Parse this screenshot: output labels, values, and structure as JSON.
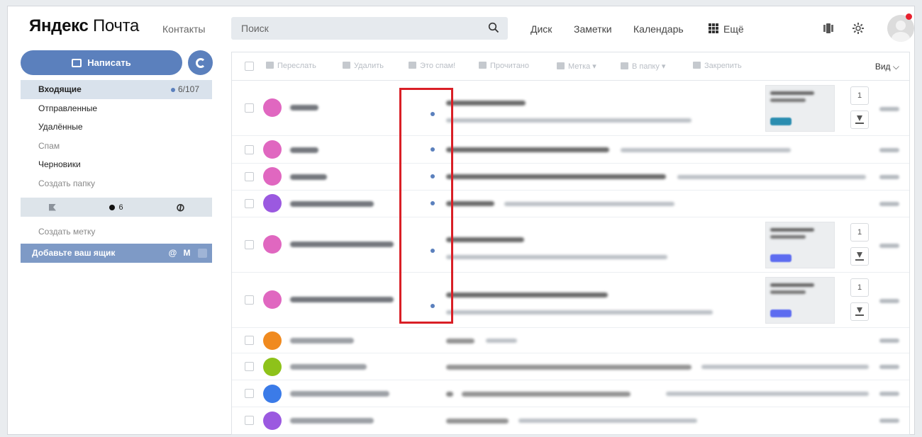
{
  "header": {
    "logo_a": "Яндекс",
    "logo_b": "Почта",
    "contacts": "Контакты",
    "search_placeholder": "Поиск",
    "nav": [
      "Диск",
      "Заметки",
      "Календарь"
    ],
    "more": "Ещё",
    "icons": [
      "search-icon",
      "grid-icon",
      "phone-icon",
      "settings-icon",
      "avatar-icon"
    ]
  },
  "sidebar": {
    "compose": "Написать",
    "folders": [
      {
        "label": "Входящие",
        "count": "6/107",
        "active": true
      },
      {
        "label": "Отправленные"
      },
      {
        "label": "Удалённые"
      },
      {
        "label": "Спам",
        "muted": true
      },
      {
        "label": "Черновики"
      },
      {
        "label": "Создать папку",
        "muted": true
      }
    ],
    "filter_unread_count": "6",
    "create_label": "Создать метку",
    "add_mailbox": "Добавьте ваш ящик"
  },
  "toolbar": {
    "forward": "Переслать",
    "delete": "Удалить",
    "spam": "Это спам!",
    "read": "Прочитано",
    "label": "Метка",
    "to_folder": "В папку",
    "pin": "Закрепить",
    "view": "Вид"
  },
  "messages": [
    {
      "unread": true,
      "avatar_color": "#e067c0",
      "has_attachments": true,
      "attach_count": "1"
    },
    {
      "unread": true,
      "avatar_color": "#e067c0"
    },
    {
      "unread": true,
      "avatar_color": "#e067c0"
    },
    {
      "unread": true,
      "avatar_color": "#9b59e0"
    },
    {
      "unread": true,
      "avatar_color": "#e067c0",
      "has_attachments": true,
      "attach_count": "1"
    },
    {
      "unread": true,
      "avatar_color": "#e067c0",
      "has_attachments": true,
      "attach_count": "1"
    },
    {
      "unread": false,
      "avatar_color": "#f08a1f"
    },
    {
      "unread": false,
      "avatar_color": "#8ec21a"
    },
    {
      "unread": false,
      "avatar_color": "#3b7be8"
    },
    {
      "unread": false,
      "avatar_color": "#9b59e0"
    }
  ],
  "colors": {
    "accent": "#5b80bd",
    "highlight": "#d91f26",
    "notification": "#e8202e"
  }
}
